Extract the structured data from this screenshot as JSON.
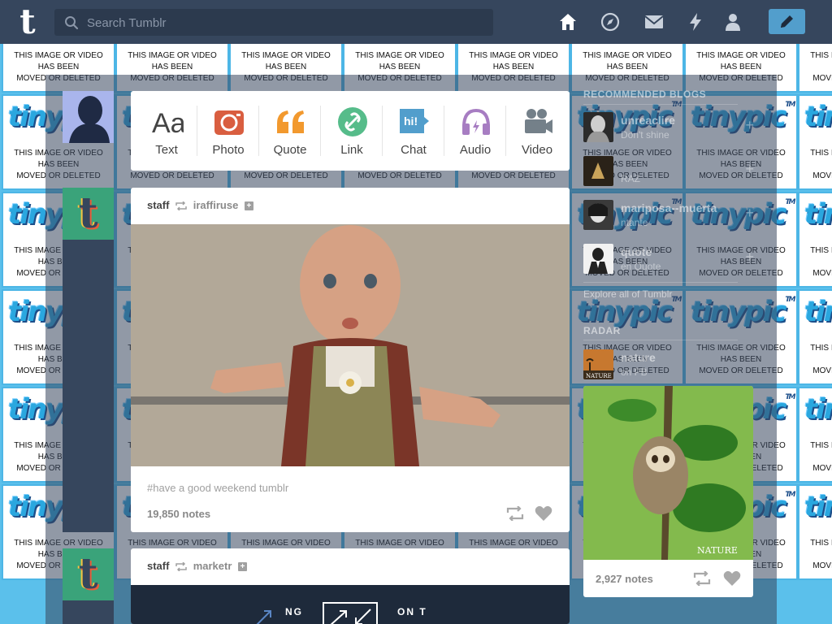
{
  "topbar": {
    "logo": "t",
    "search": {
      "placeholder": "Search Tumblr",
      "value": ""
    },
    "nav": [
      "home-icon",
      "explore-icon",
      "inbox-icon",
      "activity-icon",
      "account-icon"
    ],
    "compose_icon": "pencil-icon"
  },
  "background": {
    "placeholder_text_lines": [
      "THIS IMAGE OR VIDEO",
      "HAS BEEN",
      "MOVED OR DELETED"
    ],
    "logo_text": "tinypic",
    "logo_mark": "TM"
  },
  "post_types": [
    {
      "label": "Text",
      "icon": "text-icon",
      "color": "#444444"
    },
    {
      "label": "Photo",
      "icon": "camera-icon",
      "color": "#d95e40"
    },
    {
      "label": "Quote",
      "icon": "quote-icon",
      "color": "#f2992e"
    },
    {
      "label": "Link",
      "icon": "link-icon",
      "color": "#56bc8a"
    },
    {
      "label": "Chat",
      "icon": "chat-icon",
      "color": "#529ecc"
    },
    {
      "label": "Audio",
      "icon": "headphones-icon",
      "color": "#a77dc2"
    },
    {
      "label": "Video",
      "icon": "video-camera-icon",
      "color": "#748089"
    }
  ],
  "posts": [
    {
      "author": "staff",
      "reblogged_from": "iraffiruse",
      "tags": "#have a good weekend tumblr",
      "notes": "19,850 notes"
    },
    {
      "author": "staff",
      "reblogged_from": "marketr",
      "banner_left": "NG",
      "banner_right": "ON T"
    }
  ],
  "sidebar": {
    "recommended_heading": "RECOMMENDED BLOGS",
    "blogs": [
      {
        "name": "unreaclire",
        "sub": "Don't shine"
      },
      {
        "name": "",
        "sub": "RAZ"
      },
      {
        "name": "mariposa--muerta",
        "sub": "ntante"
      },
      {
        "name": "quote",
        "sub": "en Quote"
      }
    ],
    "explore": "Explore all of Tumblr",
    "radar_heading": "RADAR",
    "radar_blog": {
      "name": "nature",
      "sub": "on PB"
    },
    "radar_notes": "2,927 notes",
    "radar_watermark": "NATURE"
  },
  "colors": {
    "nav_bg": "#36465d",
    "compose": "#529ecc",
    "page_bg": "#5bc0eb"
  }
}
